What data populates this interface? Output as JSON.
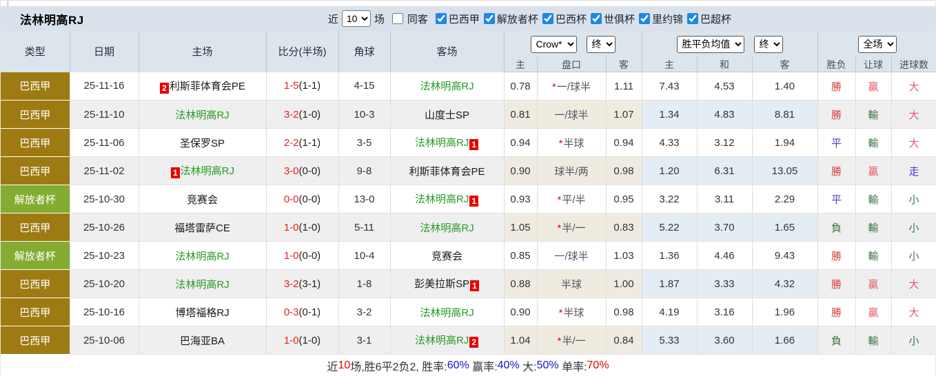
{
  "title": "法林明高RJ",
  "controls": {
    "near_label": "近",
    "matches_value": "10",
    "matches_label": "场",
    "same_away_label": "同客",
    "same_away_checked": false,
    "leagues": [
      {
        "label": "巴西甲",
        "checked": true
      },
      {
        "label": "解放者杯",
        "checked": true
      },
      {
        "label": "巴西杯",
        "checked": true
      },
      {
        "label": "世俱杯",
        "checked": true
      },
      {
        "label": "里约锦",
        "checked": true
      },
      {
        "label": "巴超杯",
        "checked": true
      }
    ]
  },
  "table": {
    "main_headers": [
      "类型",
      "日期",
      "主场",
      "比分(半场)",
      "角球",
      "客场"
    ],
    "odds_selects": {
      "bookmaker": "Crow*",
      "bookmaker_time": "终",
      "avg": "胜平负均值",
      "avg_time": "终",
      "scope": "全场"
    },
    "sub_headers": [
      "主",
      "盘口",
      "客",
      "主",
      "和",
      "客",
      "胜负",
      "让球",
      "进球数"
    ]
  },
  "colors": {
    "league": {
      "巴西甲": "#9e7b12",
      "解放者杯": "#84ac30"
    },
    "checkbox_accent": "#1e88e5",
    "self_team_green": "#289a28",
    "score_red": "#e62020",
    "card_red": "#e60000",
    "result_red": "#d84040",
    "result_pink_red": "#e25b6a",
    "result_green": "#3d7347",
    "result_blue": "#4440cc",
    "header_bg": "#dce5ec",
    "crow_col_bg": "#faf5ec",
    "avg_col_bg": "#ecf4fa"
  },
  "rows": [
    {
      "league": "巴西甲",
      "date": "25-11-16",
      "home": {
        "name": "利斯菲体育会PE",
        "self": false,
        "card": "2",
        "card_pos": "before"
      },
      "score": "1-5",
      "half": "(1-1)",
      "corner": "4-15",
      "away": {
        "name": "法林明高RJ",
        "self": true
      },
      "crow": {
        "home": "0.78",
        "handicap": "*一/球半",
        "away": "1.11"
      },
      "avg": {
        "home": "7.43",
        "draw": "4.53",
        "away": "1.40"
      },
      "result": {
        "outcome": {
          "text": "勝",
          "color": "red"
        },
        "handicap": {
          "text": "贏",
          "color": "red2"
        },
        "goals": {
          "text": "大",
          "color": "red2"
        }
      }
    },
    {
      "league": "巴西甲",
      "date": "25-11-10",
      "home": {
        "name": "法林明高RJ",
        "self": true
      },
      "score": "3-2",
      "half": "(1-0)",
      "corner": "10-3",
      "away": {
        "name": "山度士SP",
        "self": false
      },
      "crow": {
        "home": "0.81",
        "handicap": "一/球半",
        "away": "1.07"
      },
      "avg": {
        "home": "1.34",
        "draw": "4.83",
        "away": "8.81"
      },
      "result": {
        "outcome": {
          "text": "勝",
          "color": "red"
        },
        "handicap": {
          "text": "輸",
          "color": "green"
        },
        "goals": {
          "text": "大",
          "color": "red2"
        }
      }
    },
    {
      "league": "巴西甲",
      "date": "25-11-06",
      "home": {
        "name": "圣保罗SP",
        "self": false
      },
      "score": "2-2",
      "half": "(1-1)",
      "corner": "3-5",
      "away": {
        "name": "法林明高RJ",
        "self": true,
        "card": "1",
        "card_pos": "after"
      },
      "crow": {
        "home": "0.94",
        "handicap": "*半球",
        "away": "0.94"
      },
      "avg": {
        "home": "4.33",
        "draw": "3.12",
        "away": "1.94"
      },
      "result": {
        "outcome": {
          "text": "平",
          "color": "blue"
        },
        "handicap": {
          "text": "輸",
          "color": "green"
        },
        "goals": {
          "text": "大",
          "color": "red2"
        }
      }
    },
    {
      "league": "巴西甲",
      "date": "25-11-02",
      "home": {
        "name": "法林明高RJ",
        "self": true,
        "card": "1",
        "card_pos": "before"
      },
      "score": "3-0",
      "half": "(0-0)",
      "corner": "9-8",
      "away": {
        "name": "利斯菲体育会PE",
        "self": false
      },
      "crow": {
        "home": "0.90",
        "handicap": "球半/两",
        "away": "0.98"
      },
      "avg": {
        "home": "1.20",
        "draw": "6.31",
        "away": "13.05"
      },
      "result": {
        "outcome": {
          "text": "勝",
          "color": "red"
        },
        "handicap": {
          "text": "贏",
          "color": "red2"
        },
        "goals": {
          "text": "走",
          "color": "blue"
        }
      }
    },
    {
      "league": "解放者杯",
      "date": "25-10-30",
      "home": {
        "name": "竞赛会",
        "self": false
      },
      "score": "0-0",
      "half": "(0-0)",
      "corner": "13-0",
      "away": {
        "name": "法林明高RJ",
        "self": true,
        "card": "1",
        "card_pos": "after"
      },
      "crow": {
        "home": "0.93",
        "handicap": "*平/半",
        "away": "0.95"
      },
      "avg": {
        "home": "3.22",
        "draw": "3.11",
        "away": "2.29"
      },
      "result": {
        "outcome": {
          "text": "平",
          "color": "blue"
        },
        "handicap": {
          "text": "輸",
          "color": "green"
        },
        "goals": {
          "text": "小",
          "color": "green"
        }
      }
    },
    {
      "league": "巴西甲",
      "date": "25-10-26",
      "home": {
        "name": "福塔雷萨CE",
        "self": false
      },
      "score": "1-0",
      "half": "(1-0)",
      "corner": "5-11",
      "away": {
        "name": "法林明高RJ",
        "self": true
      },
      "crow": {
        "home": "1.05",
        "handicap": "*半/一",
        "away": "0.83"
      },
      "avg": {
        "home": "5.22",
        "draw": "3.70",
        "away": "1.65"
      },
      "result": {
        "outcome": {
          "text": "負",
          "color": "green"
        },
        "handicap": {
          "text": "輸",
          "color": "green"
        },
        "goals": {
          "text": "小",
          "color": "green"
        }
      }
    },
    {
      "league": "解放者杯",
      "date": "25-10-23",
      "home": {
        "name": "法林明高RJ",
        "self": true
      },
      "score": "1-0",
      "half": "(0-0)",
      "corner": "10-4",
      "away": {
        "name": "竞赛会",
        "self": false
      },
      "crow": {
        "home": "0.85",
        "handicap": "一/球半",
        "away": "1.03"
      },
      "avg": {
        "home": "1.36",
        "draw": "4.46",
        "away": "9.43"
      },
      "result": {
        "outcome": {
          "text": "勝",
          "color": "red"
        },
        "handicap": {
          "text": "輸",
          "color": "green"
        },
        "goals": {
          "text": "小",
          "color": "green"
        }
      }
    },
    {
      "league": "巴西甲",
      "date": "25-10-20",
      "home": {
        "name": "法林明高RJ",
        "self": true
      },
      "score": "3-2",
      "half": "(3-1)",
      "corner": "1-8",
      "away": {
        "name": "彭美拉斯SP",
        "self": false,
        "card": "1",
        "card_pos": "after"
      },
      "crow": {
        "home": "0.88",
        "handicap": "半球",
        "away": "1.00"
      },
      "avg": {
        "home": "1.87",
        "draw": "3.33",
        "away": "4.32"
      },
      "result": {
        "outcome": {
          "text": "勝",
          "color": "red"
        },
        "handicap": {
          "text": "贏",
          "color": "red2"
        },
        "goals": {
          "text": "大",
          "color": "red2"
        }
      }
    },
    {
      "league": "巴西甲",
      "date": "25-10-16",
      "home": {
        "name": "博塔福格RJ",
        "self": false
      },
      "score": "0-3",
      "half": "(0-1)",
      "corner": "3-2",
      "away": {
        "name": "法林明高RJ",
        "self": true
      },
      "crow": {
        "home": "0.90",
        "handicap": "*半球",
        "away": "0.98"
      },
      "avg": {
        "home": "4.19",
        "draw": "3.16",
        "away": "1.96"
      },
      "result": {
        "outcome": {
          "text": "勝",
          "color": "red"
        },
        "handicap": {
          "text": "贏",
          "color": "red2"
        },
        "goals": {
          "text": "大",
          "color": "red2"
        }
      }
    },
    {
      "league": "巴西甲",
      "date": "25-10-06",
      "home": {
        "name": "巴海亚BA",
        "self": false
      },
      "score": "1-0",
      "half": "(1-0)",
      "corner": "3-1",
      "away": {
        "name": "法林明高RJ",
        "self": true,
        "card": "2",
        "card_pos": "after"
      },
      "crow": {
        "home": "1.04",
        "handicap": "*半/一",
        "away": "0.84"
      },
      "avg": {
        "home": "5.33",
        "draw": "3.60",
        "away": "1.66"
      },
      "result": {
        "outcome": {
          "text": "負",
          "color": "green"
        },
        "handicap": {
          "text": "輸",
          "color": "green"
        },
        "goals": {
          "text": "小",
          "color": "green"
        }
      }
    }
  ],
  "footer": {
    "segments": [
      {
        "text": "近",
        "color": "dark"
      },
      {
        "text": "10",
        "color": "red"
      },
      {
        "text": "场,胜6平2负2, 胜率:",
        "color": "dark"
      },
      {
        "text": "60%",
        "color": "blue"
      },
      {
        "text": " 赢率:",
        "color": "dark"
      },
      {
        "text": "40%",
        "color": "blue"
      },
      {
        "text": " 大:",
        "color": "dark"
      },
      {
        "text": "50%",
        "color": "blue"
      },
      {
        "text": " 单率:",
        "color": "dark"
      },
      {
        "text": "70%",
        "color": "red"
      }
    ]
  }
}
